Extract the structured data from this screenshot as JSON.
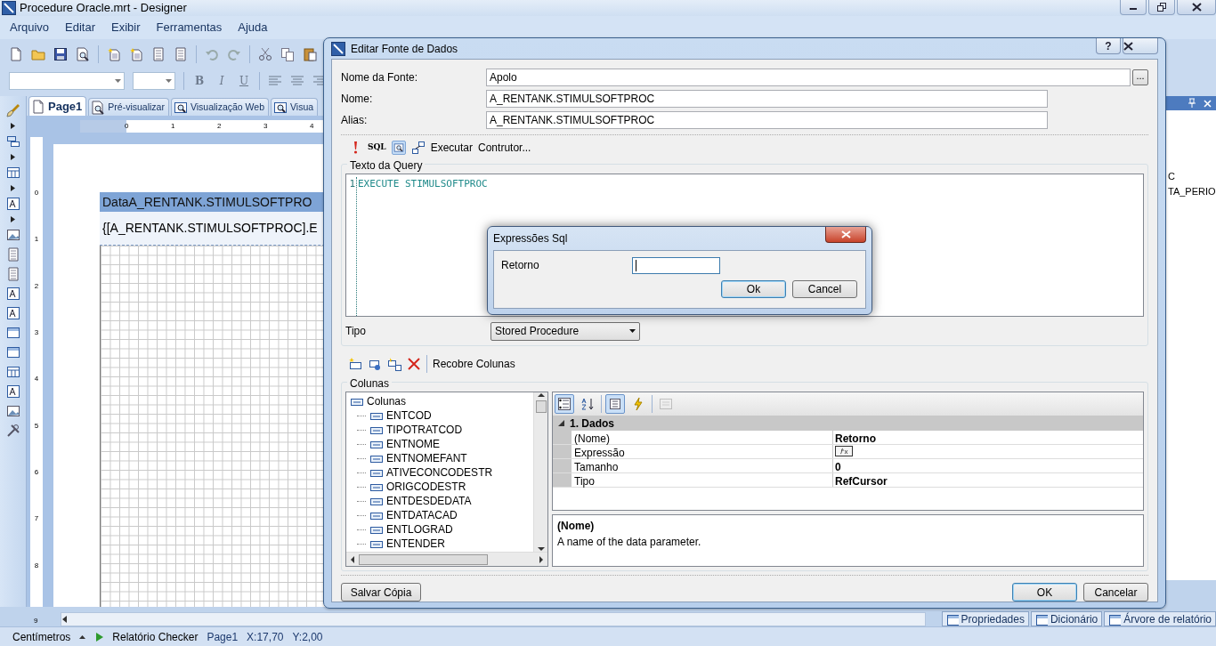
{
  "window": {
    "title": "Procedure Oracle.mrt - Designer"
  },
  "menu": [
    "Arquivo",
    "Editar",
    "Exibir",
    "Ferramentas",
    "Ajuda"
  ],
  "format_buttons": [
    "B",
    "I",
    "U"
  ],
  "tabs": [
    {
      "label": "Page1",
      "selected": true
    },
    {
      "label": "Pré-visualizar",
      "selected": false
    },
    {
      "label": "Visualização Web",
      "selected": false
    },
    {
      "label": "Visua",
      "selected": false
    }
  ],
  "ruler": {
    "h_ticks": [
      "0",
      "1",
      "2",
      "3",
      "4"
    ],
    "v_ticks": [
      "0",
      "1",
      "2",
      "3",
      "4",
      "5",
      "6",
      "7",
      "8",
      "9"
    ]
  },
  "page": {
    "band_title": "DataA_RENTANK.STIMULSOFTPRO",
    "band_field": "{[A_RENTANK.STIMULSOFTPROC].E"
  },
  "right_panel": {
    "lines": [
      "C",
      "TA_PERIO"
    ]
  },
  "dock_tabs": [
    "Propriedades",
    "Dicionário",
    "Árvore de relatório"
  ],
  "status_bar": {
    "units": "Centímetros",
    "checker": "Relatório Checker",
    "page": "Page1",
    "x": "X:17,70",
    "y": "Y:2,00"
  },
  "dialog": {
    "title": "Editar Fonte de Dados",
    "help": "?",
    "fields": [
      {
        "label": "Nome da Fonte:",
        "value": "Apolo",
        "browse": "..."
      },
      {
        "label": "Nome:",
        "value": "A_RENTANK.STIMULSOFTPROC"
      },
      {
        "label": "Alias:",
        "value": "A_RENTANK.STIMULSOFTPROC"
      }
    ],
    "query_toolbar": {
      "sql": "SQL",
      "preview_selected": true,
      "run": "Executar",
      "builder": "Contrutor..."
    },
    "query_group": "Texto da Query",
    "query_lines": [
      {
        "number": "1",
        "text": "EXECUTE STIMULSOFTPROC"
      }
    ],
    "type": {
      "label": "Tipo",
      "value": "Stored Procedure"
    },
    "columns_toolbar": "Recobre Colunas",
    "columns_group": "Colunas",
    "tree": {
      "label": "Colunas",
      "children": [
        {
          "label": "ENTCOD"
        },
        {
          "label": "TIPOTRATCOD"
        },
        {
          "label": "ENTNOME"
        },
        {
          "label": "ENTNOMEFANT"
        },
        {
          "label": "ATIVECONCODESTR"
        },
        {
          "label": "ORIGCODESTR"
        },
        {
          "label": "ENTDESDEDATA"
        },
        {
          "label": "ENTDATACAD"
        },
        {
          "label": "ENTLOGRAD"
        },
        {
          "label": "ENTENDER"
        }
      ]
    },
    "grid_toolbar": [
      {
        "kind": "categorized",
        "pressed": true,
        "disabled": false
      },
      {
        "kind": "alphabetical",
        "pressed": false,
        "disabled": false
      },
      {
        "kind": "properties",
        "pressed": true,
        "disabled": false
      },
      {
        "kind": "events",
        "pressed": false,
        "disabled": false
      },
      {
        "kind": "pages",
        "pressed": false,
        "disabled": true
      }
    ],
    "category": {
      "label": "1. Dados",
      "expanded": true
    },
    "properties": [
      {
        "name": "(Nome)",
        "kind": "text",
        "value": "Retorno"
      },
      {
        "name": "Expressão",
        "kind": "expression"
      },
      {
        "name": "Tamanho",
        "kind": "text",
        "value": "0"
      },
      {
        "name": "Tipo",
        "kind": "text",
        "value": "RefCursor"
      }
    ],
    "description": {
      "title": "(Nome)",
      "text": "A name of the data parameter."
    },
    "buttons": [
      {
        "label": "Salvar Cópia",
        "default": false
      },
      {
        "label": "OK",
        "default": true
      },
      {
        "label": "Cancelar",
        "default": false
      }
    ]
  },
  "sql_dialog": {
    "title": "Expressões Sql",
    "label": "Retorno",
    "focused": true,
    "buttons": [
      {
        "label": "Ok",
        "default": true
      },
      {
        "label": "Cancel",
        "default": false
      }
    ]
  }
}
